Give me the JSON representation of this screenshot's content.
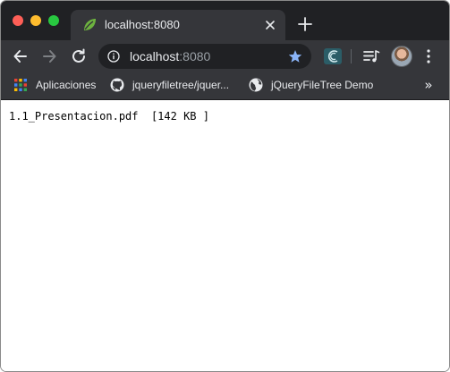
{
  "tab": {
    "title": "localhost:8080"
  },
  "omnibox": {
    "host": "localhost",
    "port": ":8080"
  },
  "bookmarks": [
    {
      "label": "Aplicaciones",
      "icon": "apps-grid-icon"
    },
    {
      "label": "jqueryfiletree/jquer...",
      "icon": "github-icon"
    },
    {
      "label": "jQueryFileTree Demo",
      "icon": "globe-icon"
    }
  ],
  "page": {
    "file_name": "1.1_Presentacion.pdf",
    "file_size": "[142 KB ]"
  },
  "colors": {
    "titlebar": "#202124",
    "toolbar": "#35363a",
    "star": "#8ab4f8",
    "spring_leaf": "#6db33f"
  }
}
